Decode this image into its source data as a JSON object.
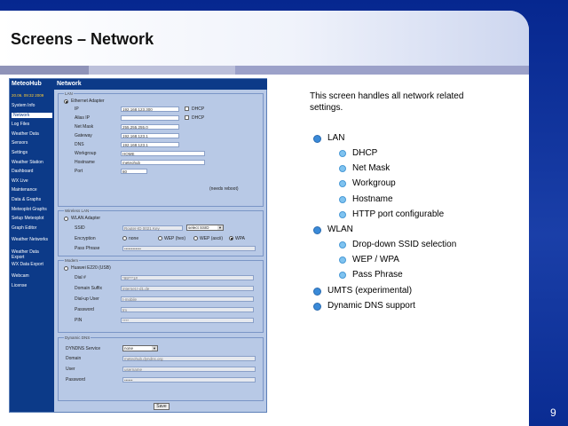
{
  "slide": {
    "title": "Screens – Network",
    "number": "9"
  },
  "description": {
    "intro": "This screen handles all network related settings.",
    "bullets": [
      {
        "label": "LAN",
        "children": [
          "DHCP",
          "Net Mask",
          "Workgroup",
          "Hostname",
          "HTTP port configurable"
        ]
      },
      {
        "label": "WLAN",
        "children": [
          "Drop-down SSID selection",
          "WEP / WPA",
          "Pass Phrase"
        ]
      },
      {
        "label": "UMTS (experimental)",
        "children": []
      },
      {
        "label": "Dynamic DNS support",
        "children": []
      }
    ]
  },
  "app": {
    "logo": "MeteoHub",
    "clock": "20.06. 09:32 2009",
    "header": "Network",
    "nav": [
      "System Info",
      "Network",
      "Log Files",
      "Weather Data",
      "Sensors",
      "Settings",
      "Weather Station",
      "Dashboard",
      "WX Live",
      "Maintenance",
      "Data & Graphs",
      "Meteoplot Graphs",
      "Setup Meteoplot",
      "Graph Editor",
      "Weather Networks",
      "Weather Data Export",
      "WX Data Export",
      "Webcam",
      "License"
    ],
    "nav_selected": 1,
    "lan": {
      "legend": "LAN",
      "mode_label": "Ethernet Adapter",
      "rows": [
        {
          "label": "IP",
          "value": "192.168.123.300"
        },
        {
          "label": "Alias IP",
          "value": ""
        },
        {
          "label": "Net Mask",
          "value": "255.255.255.0"
        },
        {
          "label": "Gateway",
          "value": "192.168.123.1"
        },
        {
          "label": "DNS",
          "value": "192.168.123.1"
        },
        {
          "label": "Workgroup",
          "value": "HOME"
        },
        {
          "label": "Hostname",
          "value": "meteohub"
        },
        {
          "label": "Port",
          "value": "80"
        }
      ],
      "dhcp_label": "DHCP",
      "dhcp2_label": "DHCP",
      "hostname_note": "(needs reboot)"
    },
    "wlan": {
      "legend": "Wireless LAN",
      "mode_label": "WLAN Adapter",
      "ssid_label": "SSID",
      "ssid_value": "Router-ID 0021 Key",
      "ssid_select": "select SSID",
      "enc_label": "Encryption",
      "enc_options": [
        "none",
        "WEP (hex)",
        "WEP (ascii)",
        "WPA"
      ],
      "enc_selected": 3,
      "pass_label": "Pass Phrase",
      "pass_value": "••••••••••••"
    },
    "umts": {
      "legend": "Modem",
      "mode_label": "Huawei E220 (USB)",
      "rows": [
        {
          "label": "Dial #",
          "value": "*99***1#"
        },
        {
          "label": "Domain Suffix",
          "value": "internet.t-d1.de"
        },
        {
          "label": "Dial-up User",
          "value": "t-mobile"
        },
        {
          "label": "Password",
          "value": "tm"
        },
        {
          "label": "PIN",
          "value": "****"
        }
      ]
    },
    "ddns": {
      "legend": "Dynamic DNS",
      "service_label": "DYNDNS Service",
      "service_value": "none",
      "rows": [
        {
          "label": "Domain",
          "value": "meteohub.dyndns.org"
        },
        {
          "label": "User",
          "value": "username"
        },
        {
          "label": "Password",
          "value": "••••••"
        }
      ]
    },
    "save_label": "Save"
  }
}
